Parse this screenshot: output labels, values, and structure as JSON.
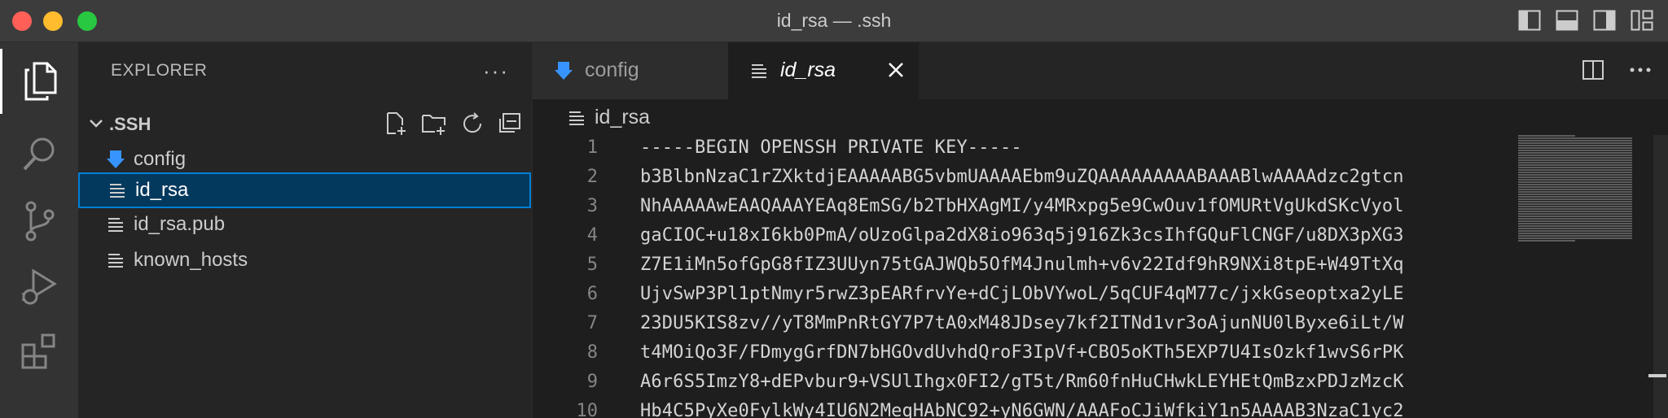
{
  "window": {
    "title": "id_rsa — .ssh"
  },
  "sidebar": {
    "title": "EXPLORER",
    "more_label": "···",
    "section": {
      "label": ".SSH"
    },
    "files": [
      {
        "name": "config",
        "icon": "download-arrow-icon"
      },
      {
        "name": "id_rsa",
        "icon": "lines-icon",
        "selected": true
      },
      {
        "name": "id_rsa.pub",
        "icon": "lines-icon"
      },
      {
        "name": "known_hosts",
        "icon": "lines-icon"
      }
    ]
  },
  "tabs": [
    {
      "label": "config",
      "icon": "download-arrow-icon",
      "active": false
    },
    {
      "label": "id_rsa",
      "icon": "lines-icon",
      "active": true
    }
  ],
  "breadcrumb": {
    "label": "id_rsa"
  },
  "editor": {
    "lines": [
      {
        "n": "1",
        "text": "-----BEGIN OPENSSH PRIVATE KEY-----"
      },
      {
        "n": "2",
        "text": "b3BlbnNzaC1rZXktdjEAAAAABG5vbmUAAAAEbm9uZQAAAAAAAAABAAABlwAAAAdzc2gtcn"
      },
      {
        "n": "3",
        "text": "NhAAAAAwEAAQAAAYEAq8EmSG/b2TbHXAgMI/y4MRxpg5e9CwOuv1fOMURtVgUkdSKcVyol"
      },
      {
        "n": "4",
        "text": "gaCIOC+u18xI6kb0PmA/oUzoGlpa2dX8io963q5j916Zk3csIhfGQuFlCNGF/u8DX3pXG3"
      },
      {
        "n": "5",
        "text": "Z7E1iMn5ofGpG8fIZ3UUyn75tGAJWQb5OfM4Jnulmh+v6v22Idf9hR9NXi8tpE+W49TtXq"
      },
      {
        "n": "6",
        "text": "UjvSwP3Pl1ptNmyr5rwZ3pEARfrvYe+dCjLObVYwoL/5qCUF4qM77c/jxkGseoptxa2yLE"
      },
      {
        "n": "7",
        "text": "23DU5KIS8zv//yT8MmPnRtGY7P7tA0xM48JDsey7kf2ITNd1vr3oAjunNU0lByxe6iLt/W"
      },
      {
        "n": "8",
        "text": "t4MOiQo3F/FDmygGrfDN7bHGOvdUvhdQroF3IpVf+CBO5oKTh5EXP7U4IsOzkf1wvS6rPK"
      },
      {
        "n": "9",
        "text": "A6r6S5ImzY8+dEPvbur9+VSUlIhgx0FI2/gT5t/Rm60fnHuCHwkLEYHEtQmBzxPDJzMzcK"
      },
      {
        "n": "10",
        "text": "Hb4C5PyXe0FylkWy4IU6N2MeqHAbNC92+yN6GWN/AAAFoCJiWfkiY1n5AAAAB3NzaC1yc2"
      }
    ]
  },
  "colors": {
    "accent": "#007fd4",
    "selection": "#04395e",
    "config_icon": "#3794ff"
  }
}
